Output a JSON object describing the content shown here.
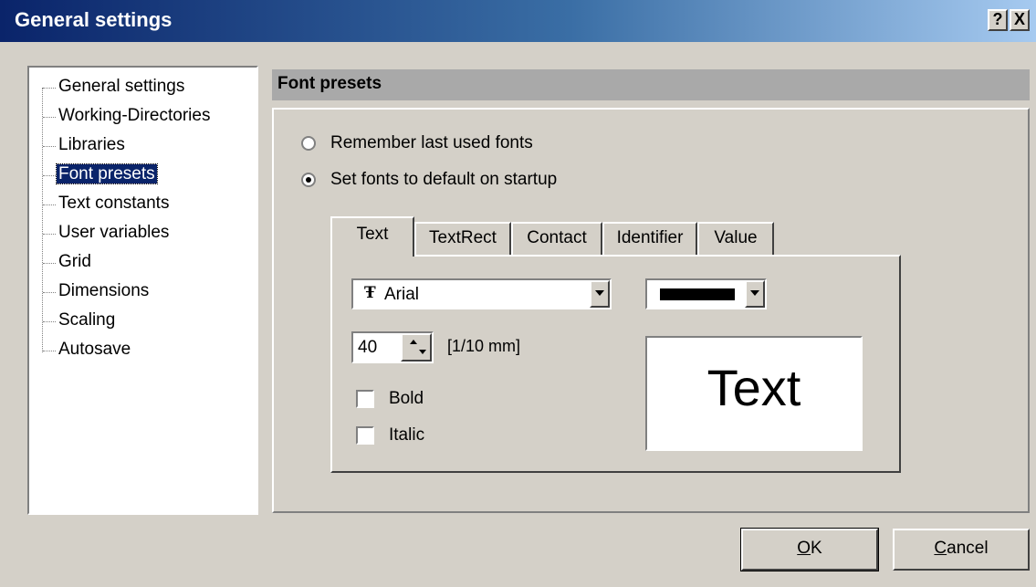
{
  "window": {
    "title": "General settings",
    "help_button": "?",
    "close_button": "X"
  },
  "tree": {
    "items": [
      {
        "label": "General settings"
      },
      {
        "label": "Working-Directories"
      },
      {
        "label": "Libraries"
      },
      {
        "label": "Font presets",
        "selected": true
      },
      {
        "label": "Text constants"
      },
      {
        "label": "User variables"
      },
      {
        "label": "Grid"
      },
      {
        "label": "Dimensions"
      },
      {
        "label": "Scaling"
      },
      {
        "label": "Autosave"
      }
    ]
  },
  "panel": {
    "title": "Font presets",
    "options": [
      {
        "label": "Remember last used fonts",
        "checked": false
      },
      {
        "label": "Set fonts to default on startup",
        "checked": true
      }
    ],
    "tabs": [
      {
        "label": "Text",
        "active": true
      },
      {
        "label": "TextRect"
      },
      {
        "label": "Contact"
      },
      {
        "label": "Identifier"
      },
      {
        "label": "Value"
      }
    ],
    "font": {
      "value": "Arial",
      "icon": "truetype-font-icon"
    },
    "color": {
      "value": "#000000"
    },
    "size": {
      "value": "40",
      "unit": "[1/10 mm]"
    },
    "bold": {
      "label": "Bold",
      "checked": false
    },
    "italic": {
      "label": "Italic",
      "checked": false
    },
    "preview_text": "Text"
  },
  "buttons": {
    "ok": {
      "prefix": "O",
      "rest": "K"
    },
    "cancel": {
      "prefix": "C",
      "rest": "ancel"
    }
  }
}
